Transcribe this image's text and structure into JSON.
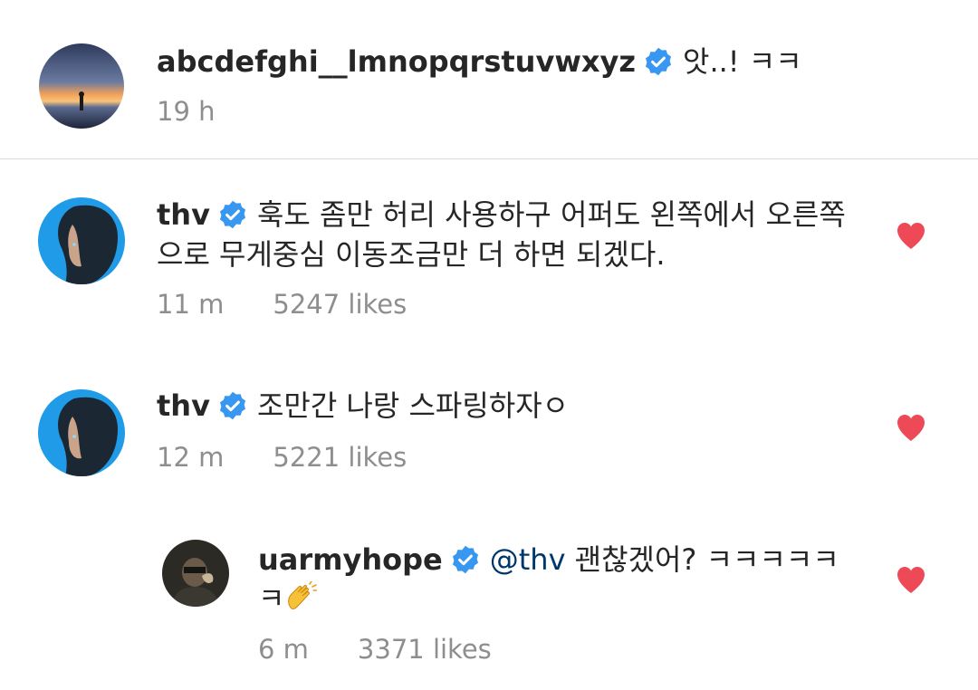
{
  "caption": {
    "username": "abcdefghi__lmnopqrstuvwxyz",
    "text": "앗..! ㅋㅋ",
    "time": "19 h"
  },
  "comments": [
    {
      "username": "thv",
      "line1": "훅도 좀만 허리 사용하구 어퍼도 왼쪽에서 오른쪽",
      "line2": "으로 무게중심 이동조금만 더 하면 되겠다.",
      "time": "11 m",
      "likes": "5247 likes"
    },
    {
      "username": "thv",
      "line1": "조만간 나랑 스파링하자ㅇ",
      "time": "12 m",
      "likes": "5221 likes"
    },
    {
      "username": "uarmyhope",
      "mention": "@thv",
      "line1": "괜찮겠어? ㅋㅋㅋㅋㅋ",
      "line2": "ㅋ",
      "time": "6 m",
      "likes": "3371 likes"
    }
  ],
  "icons": {
    "verified": "verified-badge-icon",
    "heart": "heart-icon",
    "emoji": "clapping-hands-emoji"
  },
  "colors": {
    "verified": "#3897f0",
    "heart": "#ed4956",
    "mention": "#00376b",
    "meta": "#8e8e8e",
    "divider": "#dbdbdb"
  }
}
